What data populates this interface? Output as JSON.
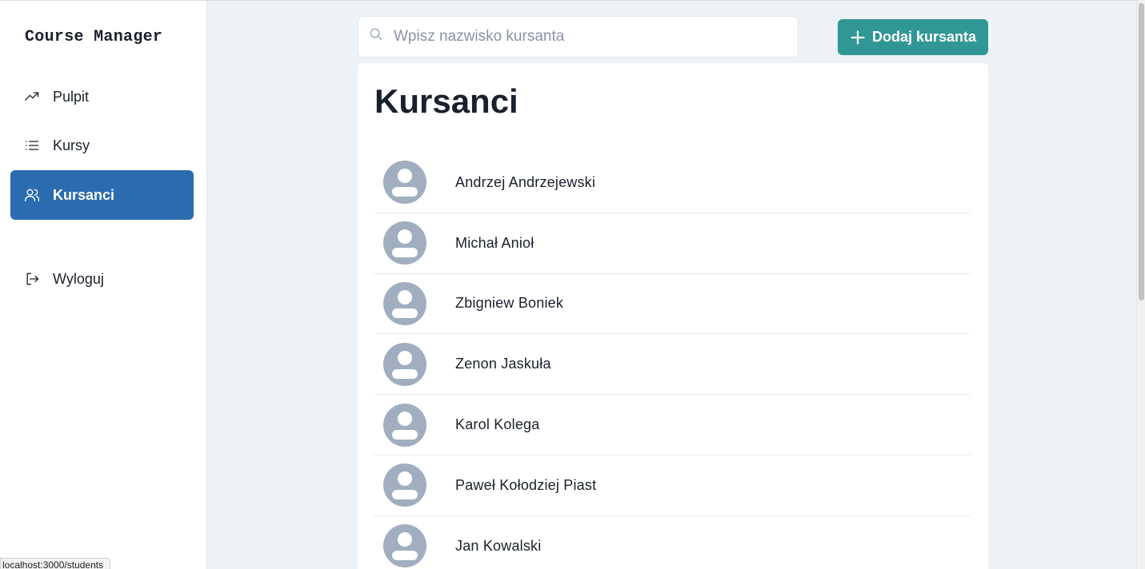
{
  "app": {
    "title": "Course Manager"
  },
  "sidebar": {
    "items": [
      {
        "label": "Pulpit",
        "icon": "trending-up-icon",
        "active": false
      },
      {
        "label": "Kursy",
        "icon": "list-icon",
        "active": false
      },
      {
        "label": "Kursanci",
        "icon": "users-icon",
        "active": true
      }
    ],
    "logout": {
      "label": "Wyloguj",
      "icon": "logout-icon"
    }
  },
  "search": {
    "placeholder": "Wpisz nazwisko kursanta",
    "value": ""
  },
  "toolbar": {
    "add_label": "Dodaj kursanta"
  },
  "main": {
    "title": "Kursanci",
    "students": [
      "Andrzej Andrzejewski",
      "Michał Anioł",
      "Zbigniew Boniek",
      "Zenon Jaskuła",
      "Karol Kolega",
      "Paweł Kołodziej Piast",
      "Jan Kowalski"
    ]
  },
  "status_bar": {
    "url": "localhost:3000/students"
  },
  "colors": {
    "accent": "#2b6cb0",
    "add_button": "#319795",
    "background": "#edf2f7",
    "avatar": "#a0aec0"
  }
}
